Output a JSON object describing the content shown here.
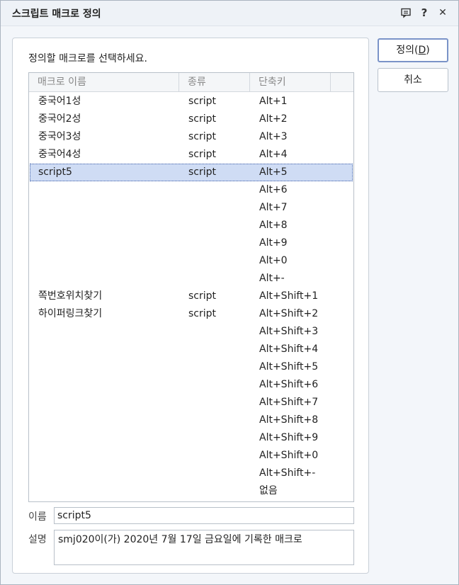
{
  "window": {
    "title": "스크립트 매크로 정의",
    "icons": [
      "comment-icon",
      "help-icon",
      "close-icon"
    ],
    "help_glyph": "?",
    "close_glyph": "✕"
  },
  "panel": {
    "instruction": "정의할 매크로를 선택하세요."
  },
  "list": {
    "columns": [
      "매크로 이름",
      "종류",
      "단축키"
    ],
    "rows": [
      {
        "name": "중국어1성",
        "type": "script",
        "key": "Alt+1"
      },
      {
        "name": "중국어2성",
        "type": "script",
        "key": "Alt+2"
      },
      {
        "name": "중국어3성",
        "type": "script",
        "key": "Alt+3"
      },
      {
        "name": "중국어4성",
        "type": "script",
        "key": "Alt+4"
      },
      {
        "name": "script5",
        "type": "script",
        "key": "Alt+5",
        "selected": true
      },
      {
        "name": "",
        "type": "",
        "key": "Alt+6"
      },
      {
        "name": "",
        "type": "",
        "key": "Alt+7"
      },
      {
        "name": "",
        "type": "",
        "key": "Alt+8"
      },
      {
        "name": "",
        "type": "",
        "key": "Alt+9"
      },
      {
        "name": "",
        "type": "",
        "key": "Alt+0"
      },
      {
        "name": "",
        "type": "",
        "key": "Alt+-"
      },
      {
        "name": "쪽번호위치찾기",
        "type": "script",
        "key": "Alt+Shift+1"
      },
      {
        "name": "하이퍼링크찾기",
        "type": "script",
        "key": "Alt+Shift+2"
      },
      {
        "name": "",
        "type": "",
        "key": "Alt+Shift+3"
      },
      {
        "name": "",
        "type": "",
        "key": "Alt+Shift+4"
      },
      {
        "name": "",
        "type": "",
        "key": "Alt+Shift+5"
      },
      {
        "name": "",
        "type": "",
        "key": "Alt+Shift+6"
      },
      {
        "name": "",
        "type": "",
        "key": "Alt+Shift+7"
      },
      {
        "name": "",
        "type": "",
        "key": "Alt+Shift+8"
      },
      {
        "name": "",
        "type": "",
        "key": "Alt+Shift+9"
      },
      {
        "name": "",
        "type": "",
        "key": "Alt+Shift+0"
      },
      {
        "name": "",
        "type": "",
        "key": "Alt+Shift+-"
      },
      {
        "name": "",
        "type": "",
        "key": "없음"
      }
    ]
  },
  "form": {
    "name_label": "이름",
    "name_value": "script5",
    "desc_label": "설명",
    "desc_value": "smj020이(가) 2020년 7월 17일 금요일에 기록한 매크로"
  },
  "buttons": {
    "define_label": "정의(",
    "define_mnemonic": "D",
    "define_close": ")",
    "cancel_label": "취소"
  },
  "colors": {
    "selection": "#cfdcf4",
    "primary_border": "#7a93c8"
  }
}
